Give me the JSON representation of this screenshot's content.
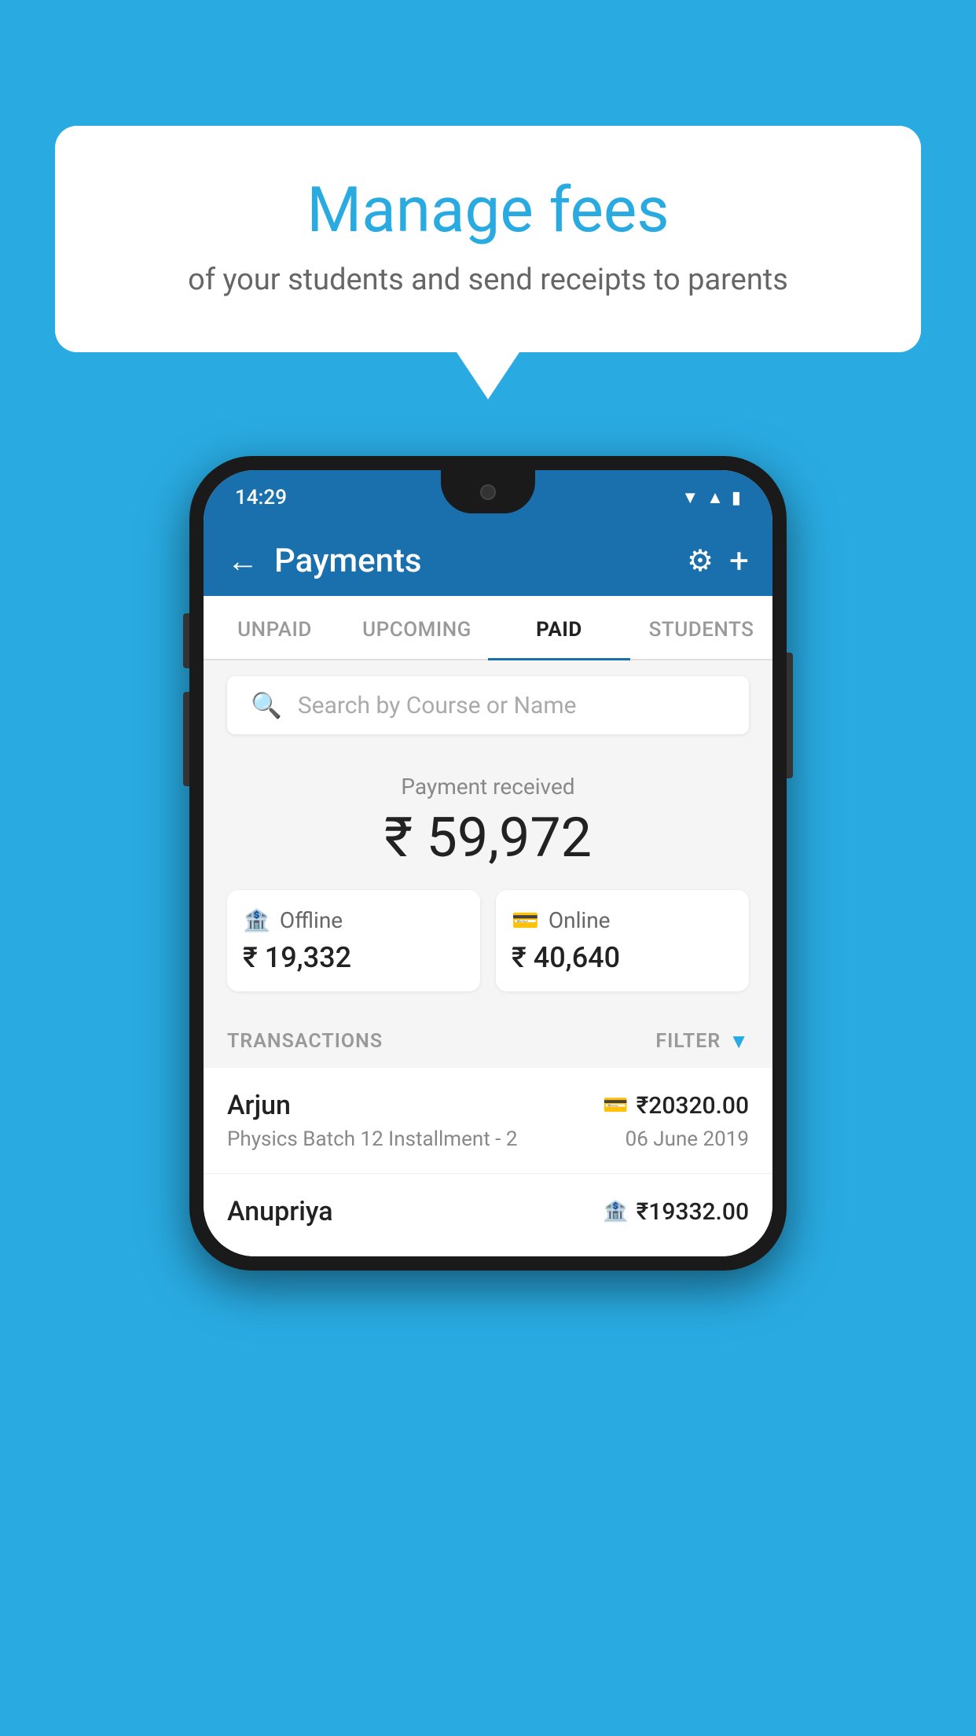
{
  "background_color": "#29ABE2",
  "speech_bubble": {
    "title": "Manage fees",
    "subtitle": "of your students and send receipts to parents"
  },
  "phone": {
    "status_bar": {
      "time": "14:29",
      "wifi_icon": "wifi-icon",
      "signal_icon": "signal-icon",
      "battery_icon": "battery-icon"
    },
    "header": {
      "title": "Payments",
      "back_label": "←",
      "gear_label": "⚙",
      "plus_label": "+"
    },
    "tabs": [
      {
        "label": "UNPAID",
        "active": false
      },
      {
        "label": "UPCOMING",
        "active": false
      },
      {
        "label": "PAID",
        "active": true
      },
      {
        "label": "STUDENTS",
        "active": false
      }
    ],
    "search": {
      "placeholder": "Search by Course or Name"
    },
    "payment_summary": {
      "label": "Payment received",
      "amount": "₹ 59,972",
      "offline": {
        "label": "Offline",
        "amount": "₹ 19,332"
      },
      "online": {
        "label": "Online",
        "amount": "₹ 40,640"
      }
    },
    "transactions": {
      "section_label": "TRANSACTIONS",
      "filter_label": "FILTER",
      "rows": [
        {
          "name": "Arjun",
          "type_icon": "card-icon",
          "amount": "₹20320.00",
          "course": "Physics Batch 12 Installment - 2",
          "date": "06 June 2019"
        },
        {
          "name": "Anupriya",
          "type_icon": "cash-icon",
          "amount": "₹19332.00",
          "course": "",
          "date": ""
        }
      ]
    }
  }
}
